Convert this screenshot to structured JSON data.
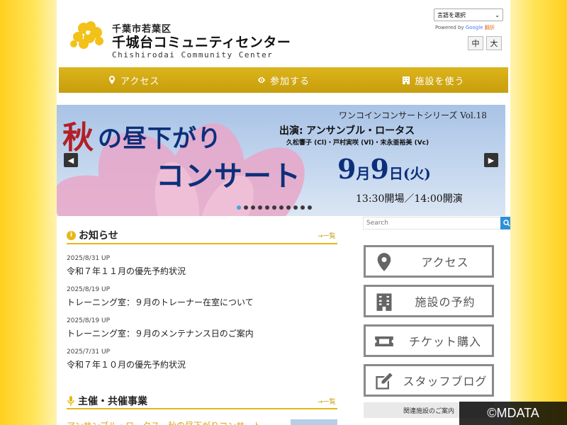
{
  "header": {
    "brand_sub": "千葉市若葉区",
    "brand_name": "千城台コミュニティセンター",
    "brand_en": "Chishirodai Community Center",
    "lang_select": "言語を選択",
    "powered_by": "Powered by",
    "google": "Google",
    "translate": "翻訳",
    "font_mid": "中",
    "font_large": "大"
  },
  "nav": [
    {
      "label": "アクセス",
      "icon": "map-pin-icon"
    },
    {
      "label": "参加する",
      "icon": "eye-icon"
    },
    {
      "label": "施設を使う",
      "icon": "building-icon"
    }
  ],
  "banner": {
    "series": "ワンコインコンサートシリーズ Vol.18",
    "aki": "秋",
    "hiru": "の昼下がり",
    "concert": "コンサート",
    "performer_label": "出演:",
    "performer": "アンサンブル・ロータス",
    "players": "久松響子 (Cl)・戸村実咲 (Vl)・末永亜裕美 (Vc)",
    "month": "9",
    "month_unit": "月",
    "day": "9",
    "day_unit": "日",
    "weekday": "(火)",
    "time": "13:30開場／14:00開演",
    "prev": "◀",
    "next": "▶",
    "slide_count": 11,
    "active_slide": 0
  },
  "news": {
    "title": "お知らせ",
    "more": "→一覧",
    "items": [
      {
        "date": "2025/8/31 UP",
        "text": "令和７年１１月の優先予約状況"
      },
      {
        "date": "2025/8/19 UP",
        "text": "トレーニング室：９月のトレーナー在室について"
      },
      {
        "date": "2025/8/19 UP",
        "text": "トレーニング室：９月のメンテナンス日のご案内"
      },
      {
        "date": "2025/7/31 UP",
        "text": "令和７年１０月の優先予約状況"
      }
    ]
  },
  "events": {
    "title": "主催・共催事業",
    "more": "→一覧",
    "first": "アンサンブル・ロータス　秋の昼下がりコンサート"
  },
  "sidebar": {
    "search_placeholder": "Search",
    "buttons": [
      {
        "label": "アクセス",
        "icon": "map-pin-icon"
      },
      {
        "label": "施設の予約",
        "icon": "building-icon"
      },
      {
        "label": "チケット購入",
        "icon": "ticket-icon"
      },
      {
        "label": "スタッフブログ",
        "icon": "edit-icon"
      }
    ],
    "related": "関連施設のご案内"
  },
  "copyright": "©MDATA",
  "colors": {
    "accent": "#e6b817",
    "nav": "#d4ab14",
    "banner_text": "#0d2f7a",
    "aki": "#b31f27"
  }
}
